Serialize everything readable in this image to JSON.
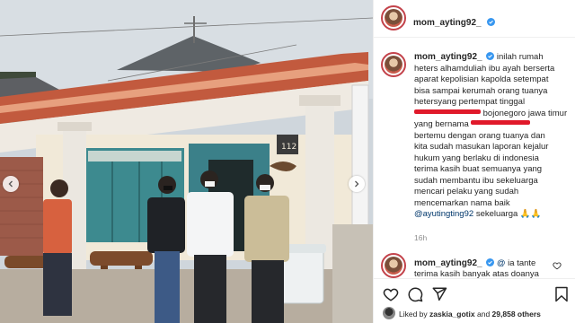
{
  "post": {
    "username": "mom_ayting92_",
    "verified": true
  },
  "caption": {
    "username": "mom_ayting92_",
    "line1": "inilah rumah",
    "line2": "heters alhamduliah ibu ayah berserta",
    "line3": "aparat kepolisian kapolda setempat",
    "line4": "bisa sampai kerumah orang tuanya",
    "line5": "hetersyang pertempat tinggal",
    "line6_suffix": "bojonegoro jawa timur",
    "line7_prefix": "yang bernama",
    "line8": "bertemu dengan orang tuanya dan",
    "line9": "kita sudah masukan laporan kejalur",
    "line10": "hukum yang berlaku di indonesia",
    "line11": "terima kasih buat semuanya yang",
    "line12": "sudah membantu ibu sekeluarga",
    "line13": "mencari pelaku yang sudah",
    "line14": "mencemarkan nama baik",
    "mention": "@ayutingting92",
    "closing": "sekeluarga 🙏🙏",
    "time": "16h"
  },
  "reply": {
    "username": "mom_ayting92_",
    "mention": "@",
    "text_part1": "ia tante",
    "text_part2": "terima kasih banyak atas doanya"
  },
  "likes": {
    "prefix": "Liked by",
    "user": "zaskia_gotix",
    "middle": "and",
    "count": "29,858 others"
  },
  "icons": {
    "like": "heart-icon",
    "comment": "comment-icon",
    "share": "paper-plane-icon",
    "save": "bookmark-icon",
    "verified": "verified-badge-icon",
    "prev": "chevron-left-icon",
    "next": "chevron-right-icon"
  },
  "colors": {
    "verified_blue": "#3897f0",
    "redaction_red": "#e0192a",
    "mention_blue": "#00376b",
    "meta_gray": "#8e8e8e"
  }
}
